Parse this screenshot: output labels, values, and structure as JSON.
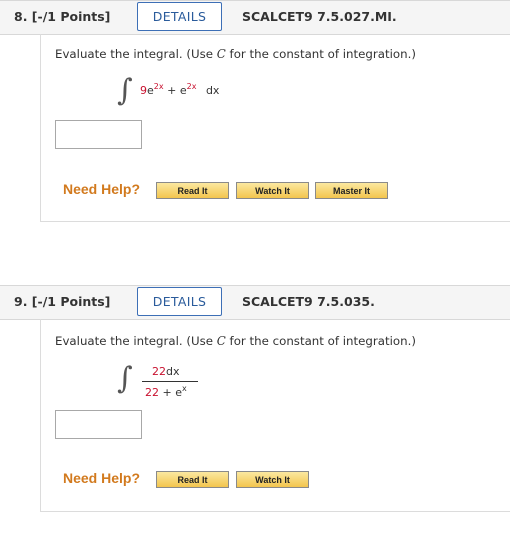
{
  "q8": {
    "number": "8. [-/1 Points]",
    "details": "DETAILS",
    "code": "SCALCET9 7.5.027.MI.",
    "prompt_pre": "Evaluate the integral. (Use ",
    "prompt_var": "C",
    "prompt_post": " for the constant of integration.)",
    "expr_coef": "9",
    "expr_e1": "e",
    "expr_exp1": "2x",
    "expr_plus": " + ",
    "expr_e2": "e",
    "expr_exp2": "2x",
    "expr_dx": "dx",
    "need_help": "Need Help?",
    "buttons": [
      "Read It",
      "Watch It",
      "Master It"
    ]
  },
  "q9": {
    "number": "9. [-/1 Points]",
    "details": "DETAILS",
    "code": "SCALCET9 7.5.035.",
    "prompt_pre": "Evaluate the integral. (Use ",
    "prompt_var": "C",
    "prompt_post": " for the constant of integration.)",
    "numerator_coef": "22",
    "numerator_dx": "dx",
    "denominator_const": "22",
    "denominator_plus": " + ",
    "denominator_e": "e",
    "denominator_exp": "x",
    "need_help": "Need Help?",
    "buttons": [
      "Read It",
      "Watch It"
    ]
  },
  "colors": {
    "details_border": "#3d6fb6",
    "red_number": "#c8102e",
    "need_help": "#d27a1e"
  }
}
